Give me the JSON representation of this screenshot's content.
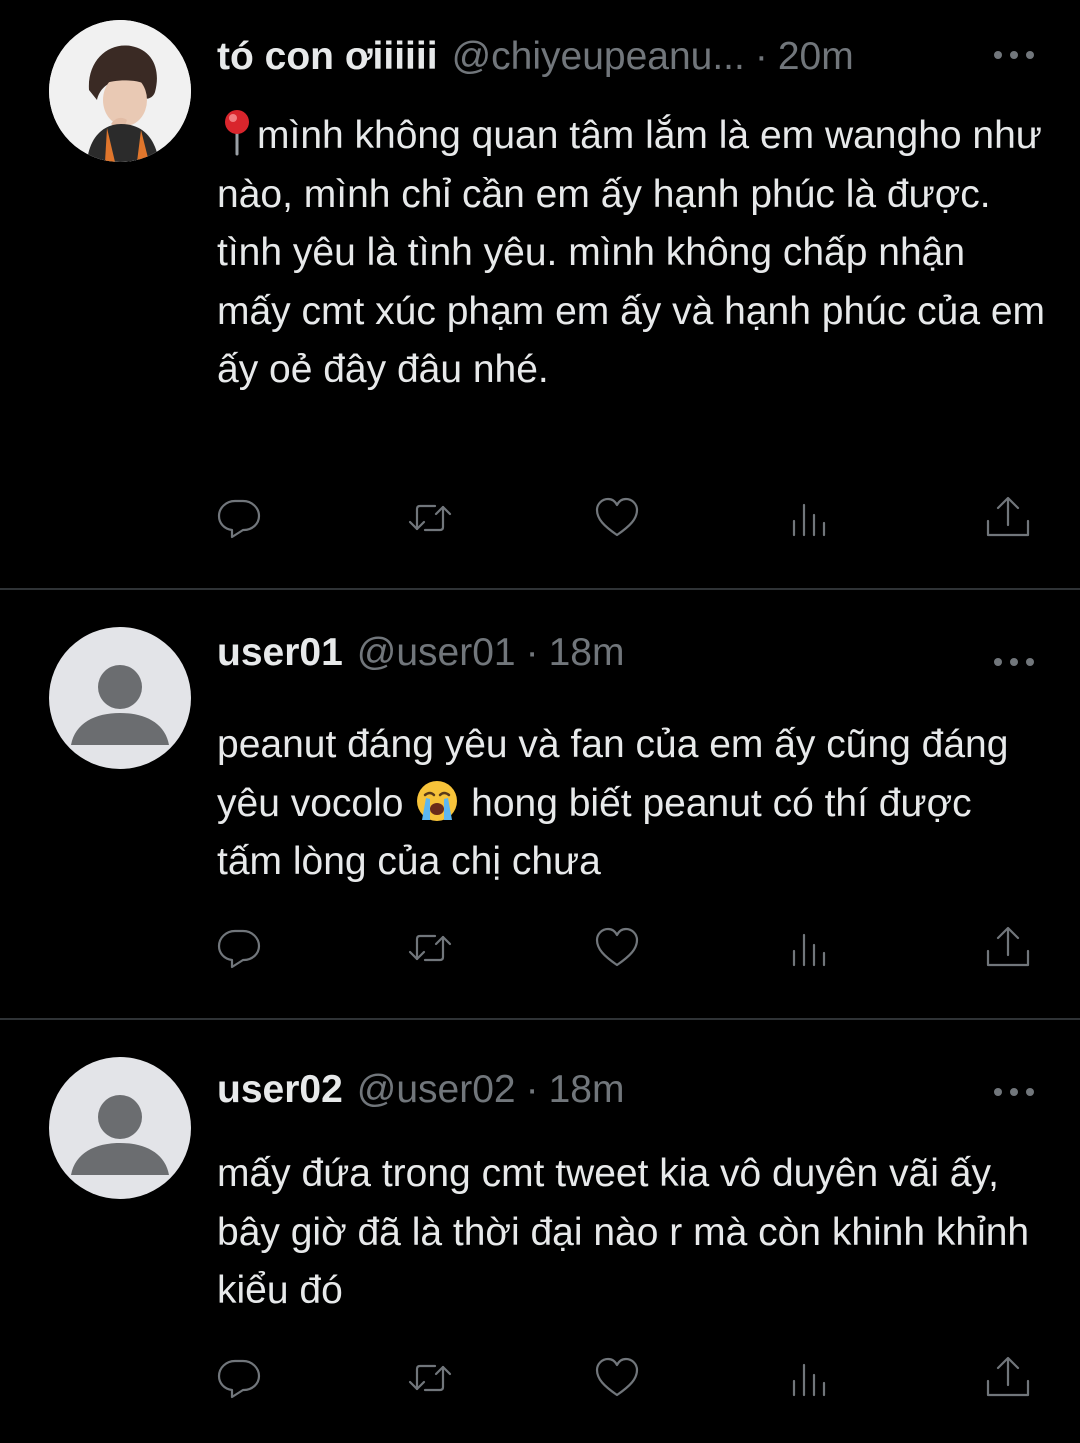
{
  "tweets": [
    {
      "display_name": "tó con ơiiiiii",
      "handle": "@chiyeupeanu...",
      "separator": "·",
      "time": "20m",
      "text_prefix_icon": "round-pushpin-emoji",
      "text": "mình không quan tâm lắm là em wangho như nào, mình chỉ cần em ấy hạnh phúc là được. tình yêu là tình yêu. mình không chấp nhận mấy cmt xúc phạm em ấy và hạnh phúc của em ấy oẻ đây đâu nhé.",
      "avatar": "photo-avatar"
    },
    {
      "display_name": "user01",
      "handle": "@user01",
      "separator": "·",
      "time": "18m",
      "text_part1": "peanut đáng yêu và fan của em ấy cũng đáng yêu vocolo",
      "text_emoji": "loudly-crying-face-emoji",
      "text_part2": "hong biết peanut có thí được tấm lòng của chị chưa",
      "avatar": "default-avatar"
    },
    {
      "display_name": "user02",
      "handle": "@user02",
      "separator": "·",
      "time": "18m",
      "text": "mấy đứa trong cmt tweet kia vô duyên vãi ấy, bây giờ đã là thời đại nào r mà còn khinh khỉnh kiểu đó",
      "avatar": "default-avatar"
    }
  ],
  "action_icons": [
    "reply-icon",
    "retweet-icon",
    "like-icon",
    "views-icon",
    "share-icon"
  ],
  "colors": {
    "background": "#000000",
    "primary_text": "#e7e9ea",
    "secondary_text": "#71767b",
    "divider": "#2f3336"
  }
}
